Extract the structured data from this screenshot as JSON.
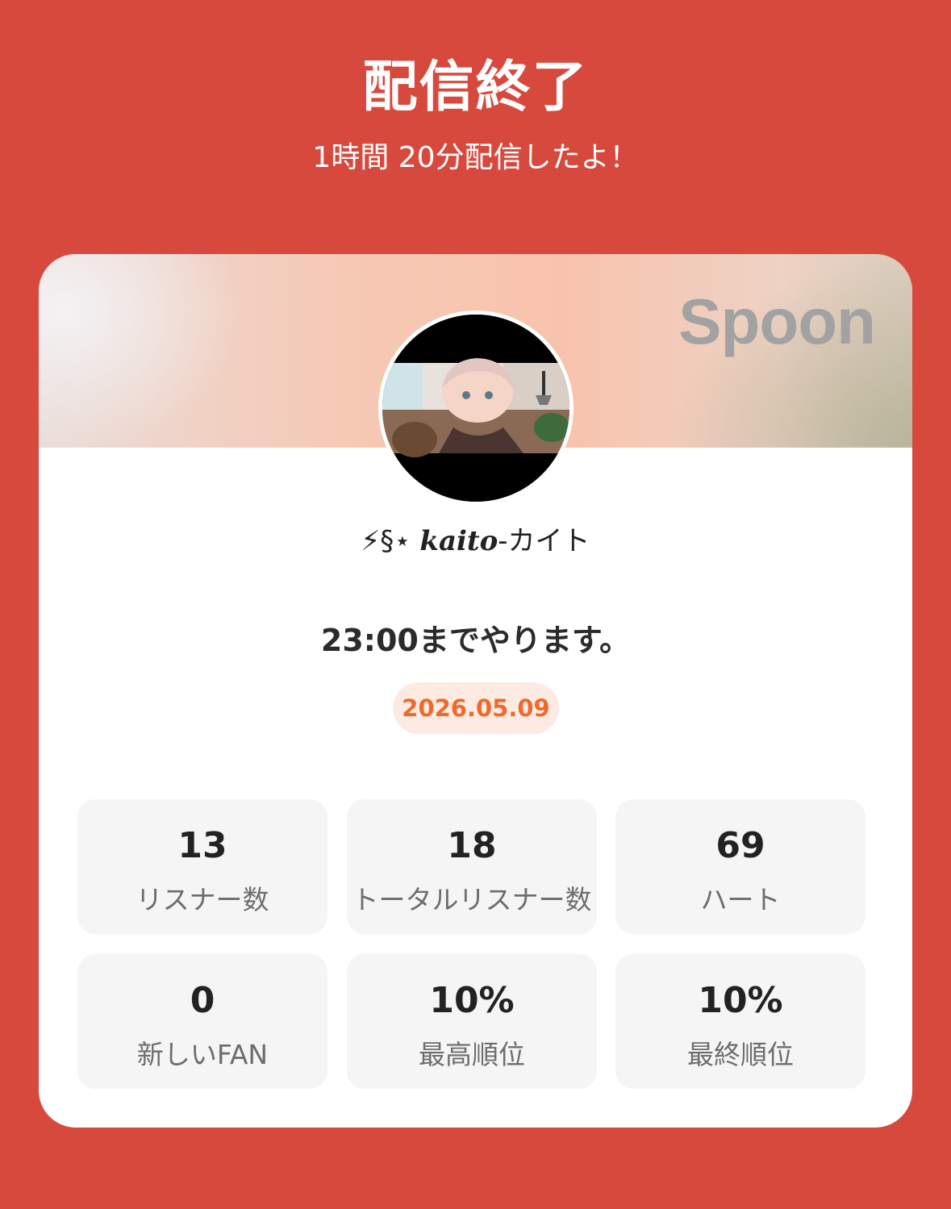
{
  "header": {
    "title": "配信終了",
    "subtitle": "1時間 20分配信したよ！"
  },
  "card": {
    "brand": "Spoon",
    "username_prefix": "⚡§⋆ ",
    "username_styled": "kaito",
    "username_suffix": "-カイト",
    "live_title": "23:00までやります。",
    "date": "2026.05.09"
  },
  "stats": [
    {
      "value": "13",
      "label": "リスナー数"
    },
    {
      "value": "18",
      "label": "トータルリスナー数"
    },
    {
      "value": "69",
      "label": "ハート"
    },
    {
      "value": "0",
      "label": "新しいFAN"
    },
    {
      "value": "10%",
      "label": "最高順位"
    },
    {
      "value": "10%",
      "label": "最終順位"
    }
  ],
  "colors": {
    "background": "#d8493d",
    "badge_text": "#ef6a2a",
    "badge_bg": "#fdebe3"
  }
}
